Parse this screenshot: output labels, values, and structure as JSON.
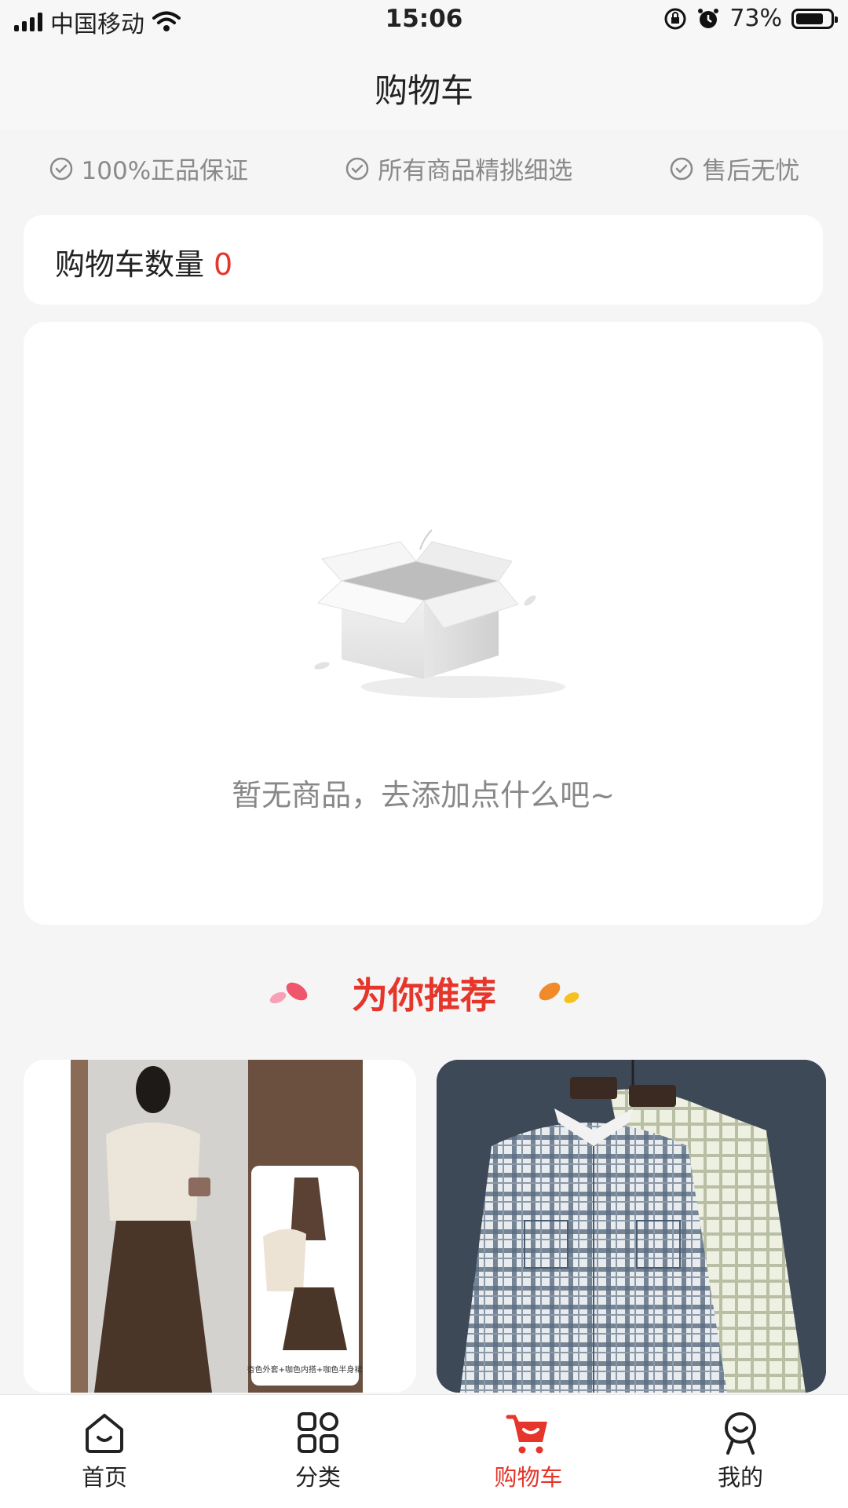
{
  "status_bar": {
    "carrier": "中国移动",
    "time": "15:06",
    "battery": "73%"
  },
  "header": {
    "title": "购物车"
  },
  "guarantees": [
    {
      "label": "100%正品保证",
      "icon": "check-circle-icon"
    },
    {
      "label": "所有商品精挑细选",
      "icon": "check-circle-icon"
    },
    {
      "label": "售后无忧",
      "icon": "check-circle-icon"
    }
  ],
  "cart": {
    "count_label": "购物车数量",
    "count": "0"
  },
  "empty_state": {
    "message": "暂无商品，去添加点什么吧~",
    "icon": "empty-box-illustration"
  },
  "recommend": {
    "title": "为你推荐",
    "products": [
      {
        "image": "product-image-outfit-beige-jacket-brown-skirt",
        "caption": "杏色外套+咖色内搭+咖色半身裙"
      },
      {
        "image": "product-image-plaid-shirts"
      }
    ]
  },
  "tabbar": {
    "items": [
      {
        "label": "首页",
        "icon": "home-icon",
        "active": false
      },
      {
        "label": "分类",
        "icon": "category-grid-icon",
        "active": false
      },
      {
        "label": "购物车",
        "icon": "cart-icon",
        "active": true
      },
      {
        "label": "我的",
        "icon": "profile-icon",
        "active": false
      }
    ]
  },
  "colors": {
    "accent": "#e6352a",
    "background": "#f5f5f5",
    "muted_text": "#888888"
  }
}
